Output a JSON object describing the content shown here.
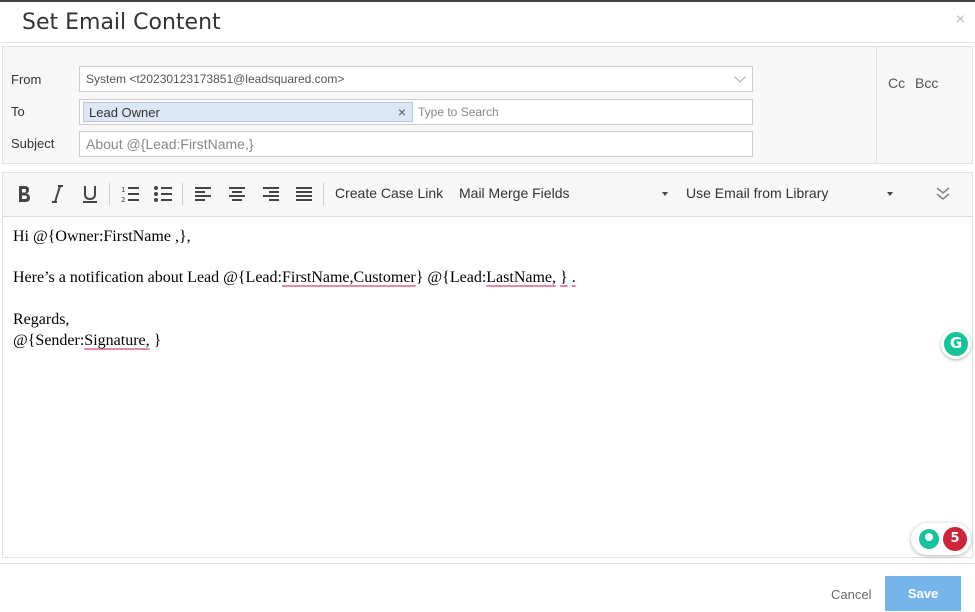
{
  "dialog": {
    "title": "Set Email Content",
    "close_symbol": "×"
  },
  "fields": {
    "from_label": "From",
    "from_value": "System <t20230123173851@leadsquared.com>",
    "to_label": "To",
    "to_chip": "Lead Owner",
    "to_chip_remove": "×",
    "to_placeholder": "Type to Search",
    "subject_label": "Subject",
    "subject_value": "About @{Lead:FirstName,}",
    "cc": "Cc",
    "bcc": "Bcc"
  },
  "toolbar": {
    "icons": [
      "bold-icon",
      "italic-icon",
      "underline-icon",
      "ordered-list-icon",
      "unordered-list-icon",
      "align-left-icon",
      "align-center-icon",
      "align-right-icon",
      "justify-icon",
      "expand-chevron-icon"
    ],
    "create_case_link": "Create Case Link",
    "mail_merge": "Mail Merge Fields",
    "email_library": "Use Email from Library"
  },
  "editor": {
    "l1": "Hi @{Owner:FirstName ,},",
    "l2_a": "Here’s a notification about Lead @{Lead:",
    "l2_b": "FirstName,Customer",
    "l2_c": "} @{Lead:",
    "l2_d": "LastName,",
    "l2_e": " ",
    "l2_f": "}",
    "l2_g": " ",
    "l2_h": ".",
    "l3": "Regards,",
    "l4_a": "@{Sender:",
    "l4_b": "Signature,",
    "l4_c": " }"
  },
  "grammarly": {
    "letter": "G",
    "count": "5"
  },
  "footer": {
    "cancel": "Cancel",
    "save": "Save"
  },
  "colors": {
    "save_button": "#75b5ea",
    "chip_bg": "#dce6f5",
    "grammarly_green": "#15c39a",
    "badge_red": "#d0243d",
    "squiggle": "#e58aa5"
  }
}
